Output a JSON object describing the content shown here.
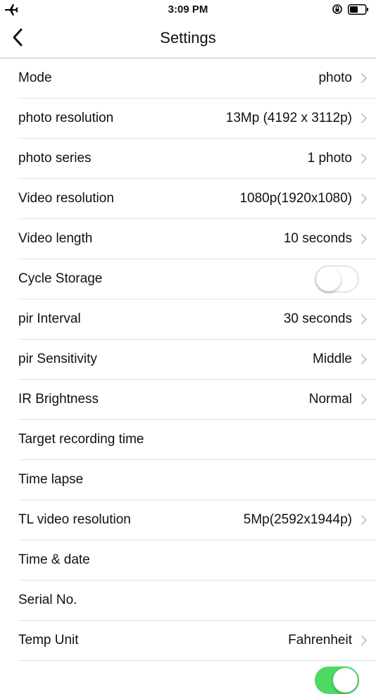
{
  "status": {
    "time": "3:09 PM"
  },
  "nav": {
    "title": "Settings"
  },
  "rows": [
    {
      "label": "Mode",
      "value": "photo"
    },
    {
      "label": "photo resolution",
      "value": "13Mp (4192 x 3112p)"
    },
    {
      "label": "photo series",
      "value": "1 photo"
    },
    {
      "label": "Video resolution",
      "value": "1080p(1920x1080)"
    },
    {
      "label": "Video length",
      "value": "10 seconds"
    },
    {
      "label": "Cycle Storage",
      "toggle": "off"
    },
    {
      "label": "pir Interval",
      "value": "30 seconds"
    },
    {
      "label": "pir Sensitivity",
      "value": "Middle"
    },
    {
      "label": "IR Brightness",
      "value": "Normal"
    },
    {
      "label": "Target recording time"
    },
    {
      "label": "Time lapse"
    },
    {
      "label": "TL video resolution",
      "value": "5Mp(2592x1944p)"
    },
    {
      "label": "Time & date"
    },
    {
      "label": "Serial No."
    },
    {
      "label": "Temp Unit",
      "value": "Fahrenheit"
    },
    {
      "label": "",
      "toggle": "on"
    }
  ],
  "colors": {
    "toggle_on": "#4cd964",
    "chevron": "#c7c7cc",
    "divider": "#e4e4e4"
  }
}
